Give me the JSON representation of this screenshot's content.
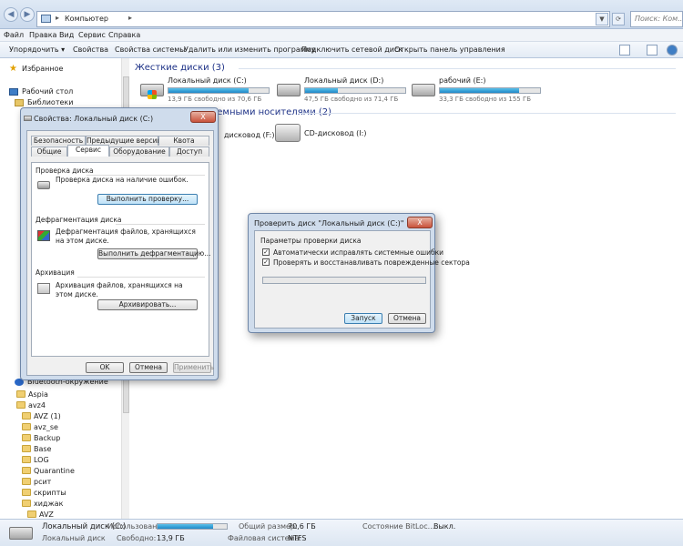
{
  "address": {
    "crumb": "Компьютер",
    "search_placeholder": "Поиск: Ком..."
  },
  "menu": [
    "Файл",
    "Правка",
    "Вид",
    "Сервис",
    "Справка"
  ],
  "toolbar": {
    "organize": "Упорядочить ▾",
    "properties": "Свойства",
    "system_properties": "Свойства системы",
    "uninstall": "Удалить или изменить программу",
    "map_drive": "Подключить сетевой диск",
    "control_panel": "Открыть панель управления"
  },
  "nav": {
    "favorites": "Избранное",
    "desktop": "Рабочий стол",
    "libraries": "Библиотеки",
    "bluetooth": "Bluetooth-окружение",
    "folders": [
      "Aspia",
      "avz4",
      "AVZ  (1)",
      "avz_se",
      "Backup",
      "Base",
      "LOG",
      "Quarantine",
      "рсит",
      "скрипты",
      "хиджак",
      "AVZ"
    ]
  },
  "content": {
    "hdd_group": "Жесткие диски (3)",
    "removable_group": "Устройства со съемными носителями (2)",
    "drives": [
      {
        "name": "Локальный диск (C:)",
        "free": "13,9 ГБ свободно из 70,6 ГБ",
        "used_fraction": 0.8
      },
      {
        "name": "Локальный диск (D:)",
        "free": "47,5 ГБ свободно из 71,4 ГБ",
        "used_fraction": 0.33
      },
      {
        "name": "рабочий (E:)",
        "free": "33,3 ГБ свободно из 155 ГБ",
        "used_fraction": 0.79
      }
    ],
    "removable": [
      {
        "name": "дисковод (F:)"
      },
      {
        "name": "CD-дисковод (I:)"
      }
    ]
  },
  "status": {
    "drive_name": "Локальный диск (C:)",
    "drive_type": "Локальный диск",
    "used_label": "Использовано:",
    "used_fraction": 0.8,
    "free_label": "Свободно:",
    "free_value": "13,9 ГБ",
    "total_label": "Общий размер:",
    "total_value": "70,6 ГБ",
    "fs_label": "Файловая система:",
    "fs_value": "NTFS",
    "bitlocker_label": "Состояние BitLoc...",
    "bitlocker_value": "Выкл."
  },
  "props": {
    "title": "Свойства: Локальный диск (C:)",
    "close": "X",
    "tabs_row1": [
      "Безопасность",
      "Предыдущие версии",
      "Квота"
    ],
    "tabs_row2": [
      "Общие",
      "Сервис",
      "Оборудование",
      "Доступ"
    ],
    "check_header": "Проверка диска",
    "check_text": "Проверка диска на наличие ошибок.",
    "check_button": "Выполнить проверку...",
    "defrag_header": "Дефрагментация диска",
    "defrag_text": "Дефрагментация файлов, хранящихся на этом диске.",
    "defrag_button": "Выполнить дефрагментацию...",
    "archive_header": "Архивация",
    "archive_text": "Архивация файлов, хранящихся на этом диске.",
    "archive_button": "Архивировать...",
    "ok": "OK",
    "cancel": "Отмена",
    "apply": "Применить"
  },
  "check": {
    "title": "Проверить диск \"Локальный диск (C:)\"",
    "close": "X",
    "options_header": "Параметры проверки диска",
    "opt1": "Автоматически исправлять системные ошибки",
    "opt2": "Проверять и восстанавливать поврежденные сектора",
    "checkmark": "✓",
    "progress": 0,
    "start": "Запуск",
    "cancel": "Отмена"
  }
}
